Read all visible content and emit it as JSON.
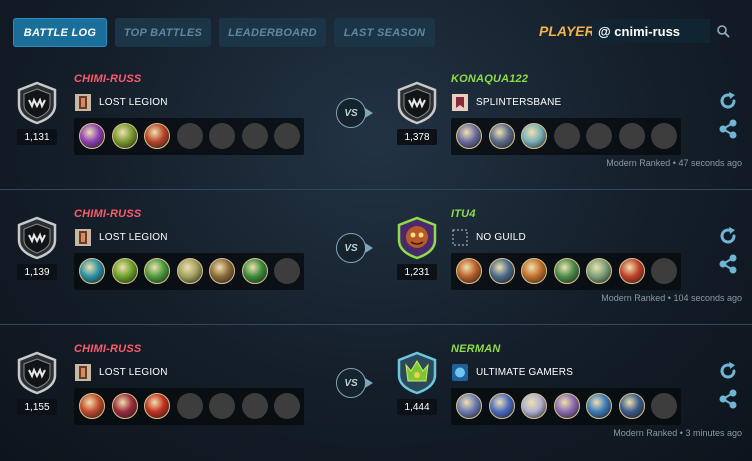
{
  "nav": {
    "tabs": [
      {
        "label": "BATTLE LOG",
        "active": true
      },
      {
        "label": "TOP BATTLES",
        "active": false
      },
      {
        "label": "LEADERBOARD",
        "active": false
      },
      {
        "label": "LAST SEASON",
        "active": false
      }
    ],
    "player_label": "PLAYER:",
    "player_value": "@ cnimi-russ"
  },
  "colors": {
    "accent": "#1a6f9a",
    "player_red": "#ff5a6e",
    "player_green": "#8fdc4a",
    "gold": "#f2b34a"
  },
  "vs_label": "VS",
  "battles": [
    {
      "left": {
        "name": "CHIMI-RUSS",
        "guild": "LOST LEGION",
        "rating": "1,131",
        "badge": "shield-badge",
        "cards": 3
      },
      "right": {
        "name": "KONAQUA122",
        "guild": "SPLINTERSBANE",
        "rating": "1,378",
        "badge": "shield-badge",
        "cards": 3
      },
      "meta": "Modern Ranked • 47 seconds ago"
    },
    {
      "left": {
        "name": "CHIMI-RUSS",
        "guild": "LOST LEGION",
        "rating": "1,139",
        "badge": "shield-badge",
        "cards": 6
      },
      "right": {
        "name": "ITU4",
        "guild": "NO GUILD",
        "rating": "1,231",
        "badge": "creature-badge",
        "cards": 6
      },
      "meta": "Modern Ranked • 104 seconds ago"
    },
    {
      "left": {
        "name": "CHIMI-RUSS",
        "guild": "LOST LEGION",
        "rating": "1,155",
        "badge": "shield-badge",
        "cards": 3
      },
      "right": {
        "name": "NERMAN",
        "guild": "ULTIMATE GAMERS",
        "rating": "1,444",
        "badge": "crown-badge",
        "cards": 6
      },
      "meta": "Modern Ranked • 3 minutes ago"
    }
  ]
}
